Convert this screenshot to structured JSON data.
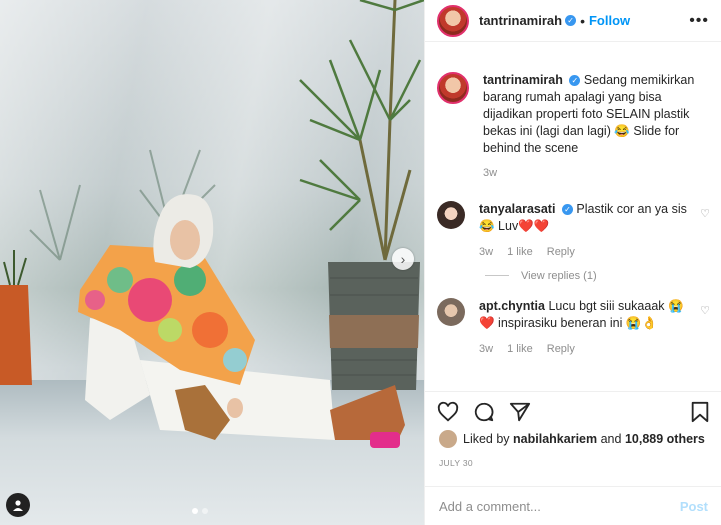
{
  "post": {
    "username": "tantrinamirah",
    "follow_label": "Follow",
    "more_icon": "more-options-icon"
  },
  "caption": {
    "username": "tantrinamirah",
    "text": "Sedang memikirkan barang rumah apalagi yang bisa dijadikan properti foto SELAIN plastik bekas ini (lagi dan lagi) 😂 Slide for behind the scene",
    "time": "3w"
  },
  "comments": [
    {
      "username": "tanyalarasati",
      "text": "Plastik cor an ya sis😂 Luv❤️❤️",
      "time": "3w",
      "likes": "1 like",
      "reply": "Reply",
      "view_replies": "View replies (1)"
    },
    {
      "username": "apt.chyntia",
      "text": "Lucu bgt siii sukaaak 😭❤️ inspirasiku beneran ini 😭👌",
      "time": "3w",
      "likes": "1 like",
      "reply": "Reply"
    }
  ],
  "likes": {
    "prefix": "Liked by",
    "user": "nabilahkariem",
    "and": "and",
    "others": "10,889 others"
  },
  "date": "JULY 30",
  "add_comment": {
    "placeholder": "Add a comment...",
    "post_label": "Post"
  },
  "colors": {
    "accent": "#0095f6",
    "verified": "#3897f0"
  }
}
